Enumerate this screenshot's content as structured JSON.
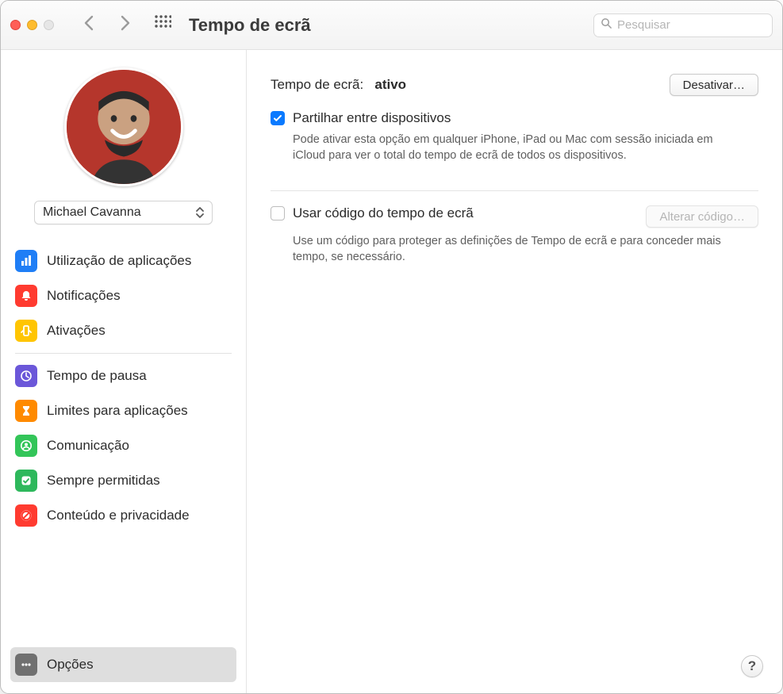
{
  "window": {
    "title": "Tempo de ecrã"
  },
  "search": {
    "placeholder": "Pesquisar",
    "value": ""
  },
  "user": {
    "name": "Michael Cavanna"
  },
  "sidebar": {
    "group1": [
      {
        "label": "Utilização de aplicações"
      },
      {
        "label": "Notificações"
      },
      {
        "label": "Ativações"
      }
    ],
    "group2": [
      {
        "label": "Tempo de pausa"
      },
      {
        "label": "Limites para aplicações"
      },
      {
        "label": "Comunicação"
      },
      {
        "label": "Sempre permitidas"
      },
      {
        "label": "Conteúdo e privacidade"
      }
    ],
    "options_label": "Opções"
  },
  "main": {
    "status_label": "Tempo de ecrã:",
    "status_value": "ativo",
    "disable_button": "Desativar…",
    "share": {
      "title": "Partilhar entre dispositivos",
      "desc": "Pode ativar esta opção em qualquer iPhone, iPad ou Mac com sessão iniciada em iCloud para ver o total do tempo de ecrã de todos os dispositivos."
    },
    "passcode": {
      "title": "Usar código do tempo de ecrã",
      "change_button": "Alterar código…",
      "desc": "Use um código para proteger as definições de Tempo de ecrã e para conceder mais tempo, se necessário."
    }
  },
  "help": {
    "glyph": "?"
  }
}
